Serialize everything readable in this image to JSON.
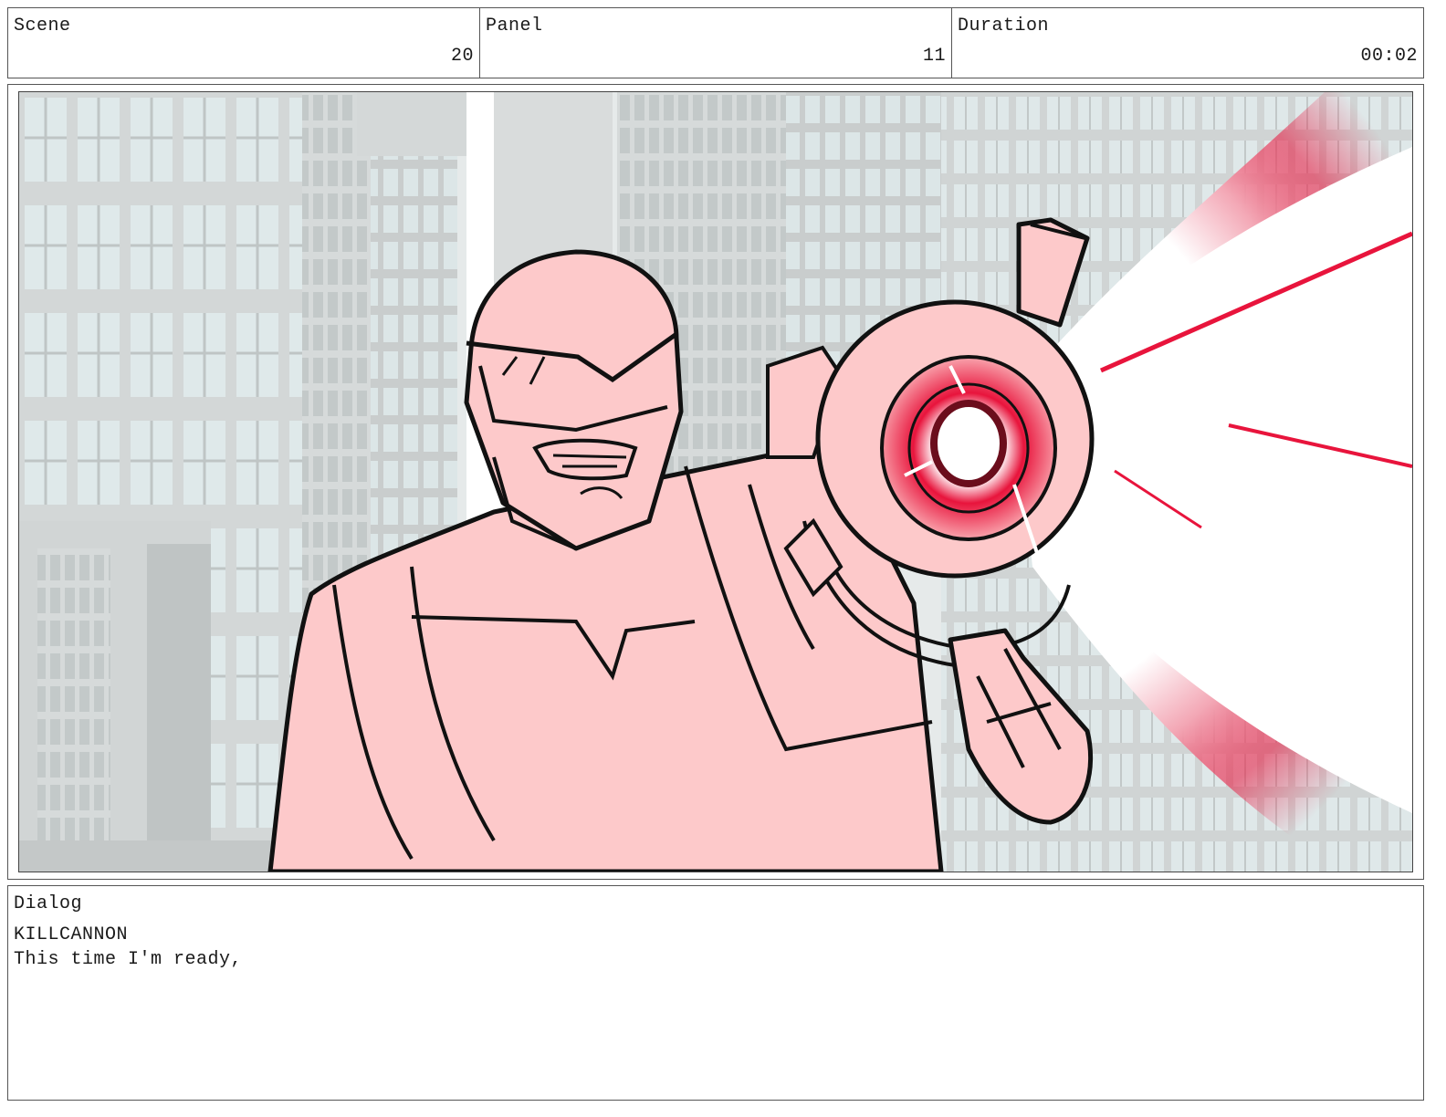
{
  "header": {
    "scene": {
      "label": "Scene",
      "value": "20"
    },
    "panel": {
      "label": "Panel",
      "value": "11"
    },
    "duration": {
      "label": "Duration",
      "value": "00:02"
    }
  },
  "artwork": {
    "subject": "character-with-cannon",
    "colors": {
      "character_fill": "#fdc9ca",
      "ink": "#111111",
      "blast_red": "#e8143c",
      "building_gray": "#cfd3d3",
      "window_glass": "#dde8e9",
      "sky": "#ffffff"
    }
  },
  "dialog": {
    "label": "Dialog",
    "speaker": "KILLCANNON",
    "line": "This time I'm ready,"
  }
}
